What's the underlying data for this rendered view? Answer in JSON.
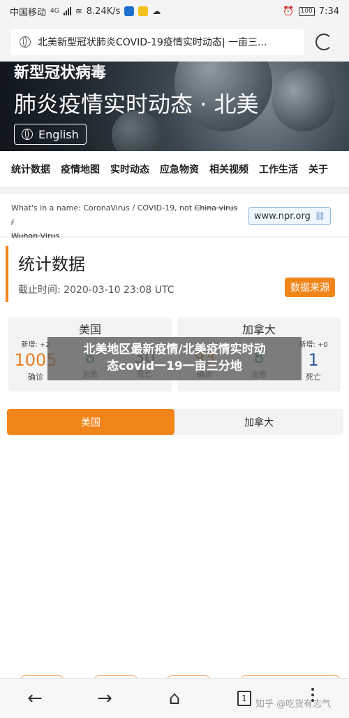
{
  "status": {
    "carrier": "中国移动",
    "network": "4G",
    "speed": "8.24K/s",
    "battery": "100",
    "time": "7:34"
  },
  "browser": {
    "url_title": "北美新型冠状肺炎COVID-19疫情实时动态| 一亩三...",
    "reload_icon": "reload-icon"
  },
  "banner": {
    "title_top": "新型冠状病毒",
    "title_main": "肺炎疫情实时动态 · 北美",
    "lang_button": "English"
  },
  "tabs": [
    "统计数据",
    "疫情地图",
    "实时动态",
    "应急物资",
    "相关视频",
    "工作生活",
    "关于"
  ],
  "notice": {
    "text_prefix": "What's in a name: CoronaVirus / COVID-19, not ",
    "strike1": "China virus /",
    "strike2": "Wuhan Virus",
    "link": "www.npr.org"
  },
  "stats": {
    "title": "统计数据",
    "cutoff": "截止时间: 2020-03-10 23:08 UTC",
    "source_button": "数据来源"
  },
  "cards": [
    {
      "name": "美国",
      "cols": [
        {
          "label": "新增: +2",
          "value": "1005",
          "name": "确诊",
          "color": "#e67e22"
        },
        {
          "label": "",
          "value": "8",
          "name": "治愈",
          "color": "#2e8b78"
        },
        {
          "label": "",
          "value": "30",
          "name": "死亡",
          "color": "#666666"
        }
      ]
    },
    {
      "name": "加拿大",
      "cols": [
        {
          "label": "",
          "value": "93",
          "name": "确诊",
          "color": "#e67e22"
        },
        {
          "label": "",
          "value": "8",
          "name": "治愈",
          "color": "#2e8b78"
        },
        {
          "label": "新增: +0",
          "value": "1",
          "name": "死亡",
          "color": "#2c5aa0"
        }
      ]
    }
  ],
  "overlay": {
    "line1": "北美地区最新疫情/北美疫情实时动",
    "line2": "态covid一19一亩三分地"
  },
  "toggle": {
    "active": "美国",
    "inactive": "加拿大"
  },
  "navbar": {
    "tab_count": "1",
    "watermark": "知乎 @吃货有志气"
  },
  "colors": {
    "accent": "#f08519"
  }
}
